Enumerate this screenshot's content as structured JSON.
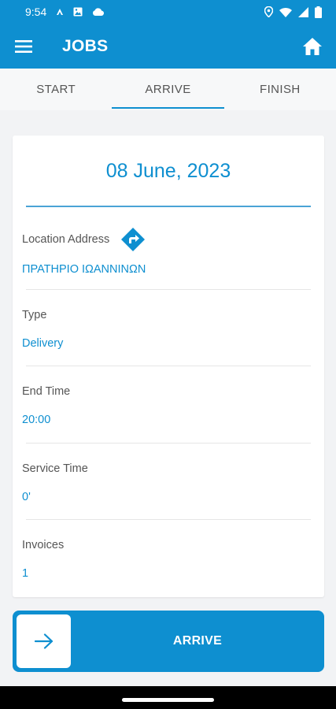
{
  "status_bar": {
    "time": "9:54",
    "icons": [
      "notification-a-icon",
      "photo-icon",
      "cloud-icon",
      "location-icon",
      "wifi-icon",
      "signal-icon",
      "battery-icon"
    ]
  },
  "app_bar": {
    "title": "JOBS",
    "menu_icon": "menu-icon",
    "home_icon": "home-icon"
  },
  "tabs": [
    {
      "label": "START",
      "active": false
    },
    {
      "label": "ARRIVE",
      "active": true
    },
    {
      "label": "FINISH",
      "active": false
    }
  ],
  "card": {
    "date": "08 June, 2023",
    "fields": [
      {
        "label": "Location Address",
        "value": "ΠΡΑΤΗΡΙΟ ΙΩΑΝΝΙΝΩΝ"
      },
      {
        "label": "Type",
        "value": "Delivery"
      },
      {
        "label": "End Time",
        "value": "20:00"
      },
      {
        "label": "Service Time",
        "value": "0'"
      },
      {
        "label": "Invoices",
        "value": "1"
      }
    ]
  },
  "action": {
    "label": "ARRIVE",
    "icon": "arrow-right-icon"
  },
  "colors": {
    "primary": "#0e8fd0",
    "background": "#f2f3f5",
    "text_secondary": "#555555"
  }
}
